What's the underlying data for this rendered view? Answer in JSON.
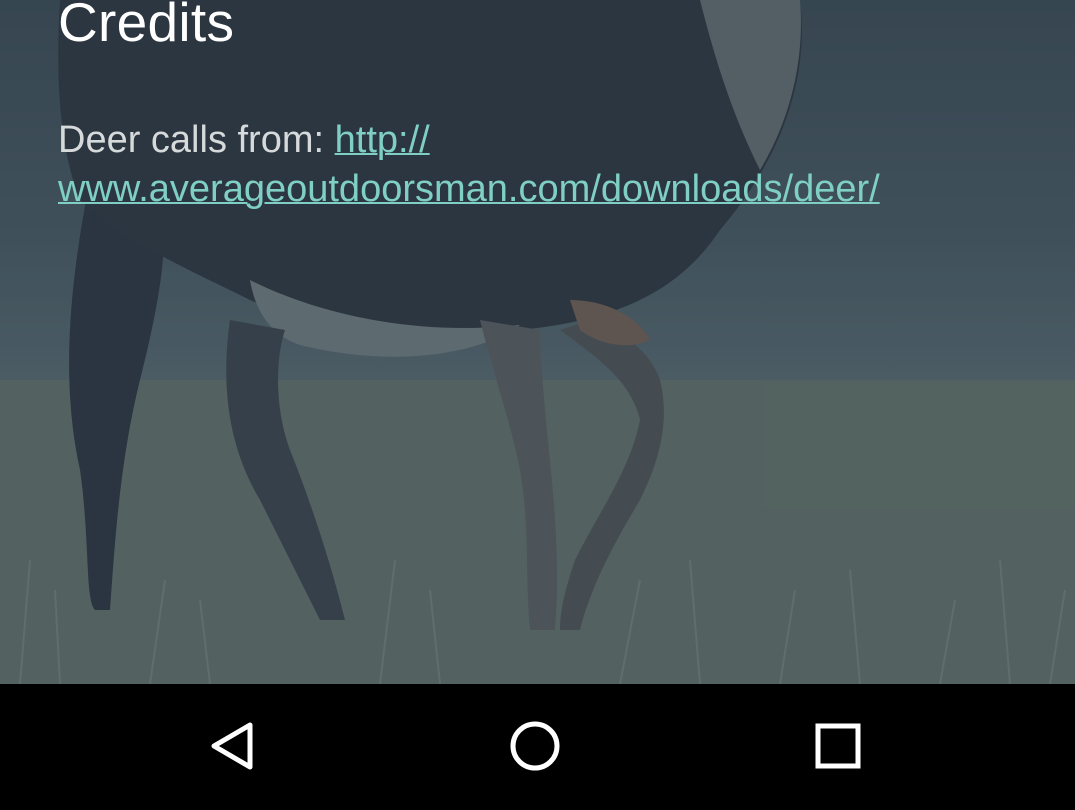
{
  "screen": {
    "title": "Credits",
    "credit_prefix": "Deer calls from: ",
    "credit_link_line1": "http://",
    "credit_link_line2": "www.averageoutdoorsman.com/downloads/deer/"
  },
  "navbar": {
    "back": "back-icon",
    "home": "home-icon",
    "recents": "recents-icon"
  },
  "colors": {
    "link": "#7fcfc4",
    "text": "#d6dadb",
    "title": "#ffffff",
    "navbar": "#000000"
  }
}
